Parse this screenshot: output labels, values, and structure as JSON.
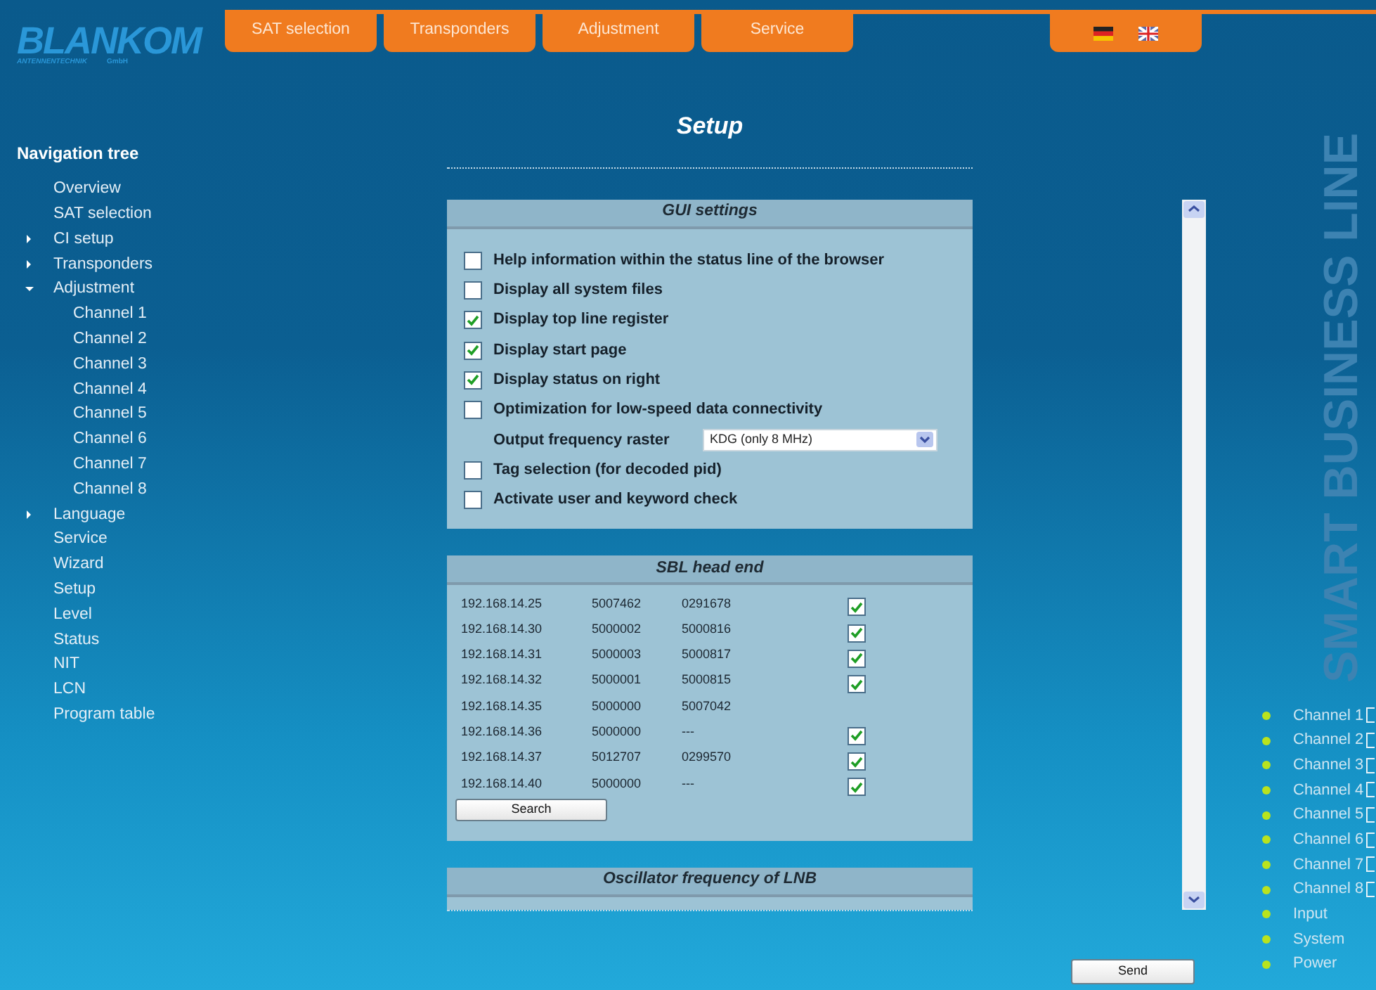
{
  "logo": {
    "name": "BLANKOM",
    "subtitle": "ANTENNENTECHNIK",
    "suffix": "GmbH"
  },
  "top_tabs": [
    "SAT selection",
    "Transponders",
    "Adjustment",
    "Service"
  ],
  "languages": [
    {
      "kind": "german"
    },
    {
      "kind": "english"
    }
  ],
  "page_title": "Setup",
  "navigation": {
    "title": "Navigation tree",
    "items": [
      {
        "label": "Overview",
        "kind": "page"
      },
      {
        "label": "SAT selection",
        "kind": "page"
      },
      {
        "label": "CI setup",
        "kind": "folder",
        "expanded": false
      },
      {
        "label": "Transponders",
        "kind": "folder",
        "expanded": false
      },
      {
        "label": "Adjustment",
        "kind": "folder",
        "expanded": true,
        "children": [
          {
            "label": "Channel 1"
          },
          {
            "label": "Channel 2"
          },
          {
            "label": "Channel 3"
          },
          {
            "label": "Channel 4"
          },
          {
            "label": "Channel 5"
          },
          {
            "label": "Channel 6"
          },
          {
            "label": "Channel 7"
          },
          {
            "label": "Channel 8"
          }
        ]
      },
      {
        "label": "Language",
        "kind": "folder",
        "expanded": false
      },
      {
        "label": "Service",
        "kind": "page"
      },
      {
        "label": "Wizard",
        "kind": "page"
      },
      {
        "label": "Setup",
        "kind": "page"
      },
      {
        "label": "Level",
        "kind": "page"
      },
      {
        "label": "Status",
        "kind": "page"
      },
      {
        "label": "NIT",
        "kind": "page"
      },
      {
        "label": "LCN",
        "kind": "page"
      },
      {
        "label": "Program table",
        "kind": "page"
      }
    ]
  },
  "gui_settings": {
    "title": "GUI settings",
    "options": [
      {
        "kind": "checkbox",
        "label": "Help information within the status line of the browser",
        "checked": false
      },
      {
        "kind": "checkbox",
        "label": "Display all system files",
        "checked": false
      },
      {
        "kind": "checkbox",
        "label": "Display top line register",
        "checked": true
      },
      {
        "kind": "checkbox",
        "label": "Display start page",
        "checked": true
      },
      {
        "kind": "checkbox",
        "label": "Display status on right",
        "checked": true
      },
      {
        "kind": "checkbox",
        "label": "Optimization for low-speed data connectivity",
        "checked": false
      },
      {
        "kind": "select",
        "label": "Output frequency raster",
        "value": "KDG (only 8 MHz)"
      },
      {
        "kind": "checkbox",
        "label": "Tag selection (for decoded pid)",
        "checked": false
      },
      {
        "kind": "checkbox",
        "label": "Activate user and keyword check",
        "checked": false
      }
    ]
  },
  "sbl_head_end": {
    "title": "SBL head end",
    "rows": [
      {
        "ip": "192.168.14.25",
        "serial": "5007462",
        "code": "0291678",
        "kind": "check",
        "checked": true
      },
      {
        "ip": "192.168.14.30",
        "serial": "5000002",
        "code": "5000816",
        "kind": "check",
        "checked": true
      },
      {
        "ip": "192.168.14.31",
        "serial": "5000003",
        "code": "5000817",
        "kind": "check",
        "checked": true
      },
      {
        "ip": "192.168.14.32",
        "serial": "5000001",
        "code": "5000815",
        "kind": "check",
        "checked": true
      },
      {
        "ip": "192.168.14.35",
        "serial": "5000000",
        "code": "5007042",
        "kind": "plain"
      },
      {
        "ip": "192.168.14.36",
        "serial": "5000000",
        "code": "---",
        "kind": "check",
        "checked": true
      },
      {
        "ip": "192.168.14.37",
        "serial": "5012707",
        "code": "0299570",
        "kind": "check",
        "checked": true
      },
      {
        "ip": "192.168.14.40",
        "serial": "5000000",
        "code": "---",
        "kind": "check",
        "checked": true
      }
    ],
    "button": "Search"
  },
  "oscillator": {
    "title": "Oscillator frequency of LNB"
  },
  "send_button": "Send",
  "brand_line": "SMART BUSINESS LINE",
  "status": [
    {
      "label": "Channel 1",
      "kind": "channel",
      "color": "#b9e31e"
    },
    {
      "label": "Channel 2",
      "kind": "channel",
      "color": "#b9e31e"
    },
    {
      "label": "Channel 3",
      "kind": "channel",
      "color": "#b9e31e"
    },
    {
      "label": "Channel 4",
      "kind": "channel",
      "color": "#b9e31e"
    },
    {
      "label": "Channel 5",
      "kind": "channel",
      "color": "#b9e31e"
    },
    {
      "label": "Channel 6",
      "kind": "channel",
      "color": "#b9e31e"
    },
    {
      "label": "Channel 7",
      "kind": "channel",
      "color": "#b9e31e"
    },
    {
      "label": "Channel 8",
      "kind": "channel",
      "color": "#b9e31e"
    },
    {
      "label": "Input",
      "kind": "plain",
      "color": "#b9e31e"
    },
    {
      "label": "System",
      "kind": "plain",
      "color": "#b9e31e"
    },
    {
      "label": "Power",
      "kind": "plain",
      "color": "#b9e31e"
    }
  ]
}
